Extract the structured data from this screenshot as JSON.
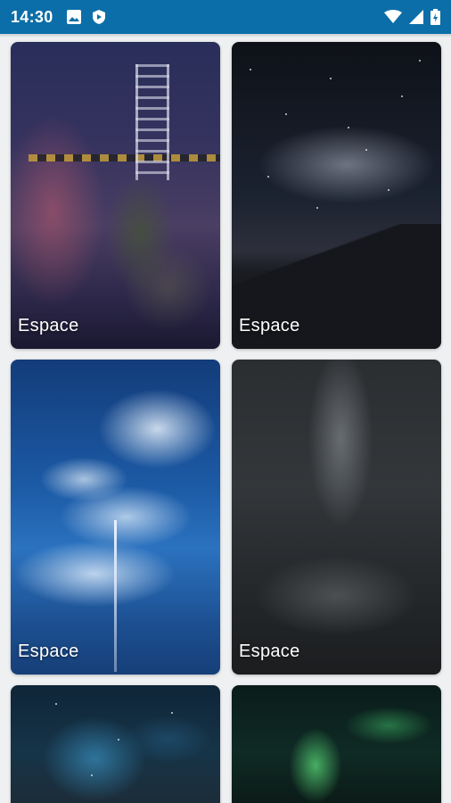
{
  "status_bar": {
    "time": "14:30",
    "background": "#0b6ea8",
    "left_icons": [
      "image-icon",
      "play-shield-icon"
    ],
    "right_icons": [
      "wifi-icon",
      "cell-signal-icon",
      "battery-charging-icon"
    ]
  },
  "cards": [
    {
      "label": "Espace",
      "image": "spacesuit-figure-photo"
    },
    {
      "label": "Espace",
      "image": "milky-way-mountains-photo"
    },
    {
      "label": "Espace",
      "image": "blue-sky-clouds-photo"
    },
    {
      "label": "Espace",
      "image": "foggy-dark-landscape-photo"
    },
    {
      "label": "",
      "image": "blue-nebula-photo"
    },
    {
      "label": "",
      "image": "green-aurora-photo"
    }
  ]
}
